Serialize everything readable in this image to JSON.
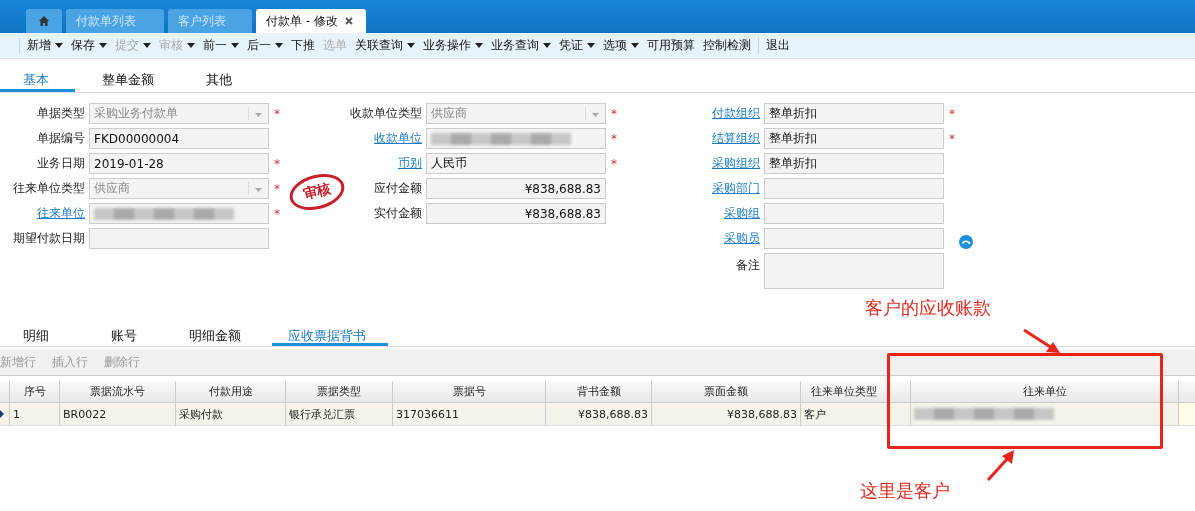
{
  "window_tabs": [
    {
      "kind": "home",
      "selected": false
    },
    {
      "kind": "text",
      "label": "付款单列表",
      "selected": false
    },
    {
      "kind": "text",
      "label": "客户列表",
      "selected": false
    },
    {
      "kind": "text",
      "label": "付款单 - 修改",
      "selected": true,
      "closable": true
    }
  ],
  "toolbar": [
    {
      "label": "新增",
      "dropdown": true,
      "disabled": false,
      "separator": false
    },
    {
      "label": "保存",
      "dropdown": true,
      "disabled": false,
      "separator": false
    },
    {
      "label": "提交",
      "dropdown": true,
      "disabled": true,
      "separator": false
    },
    {
      "label": "审核",
      "dropdown": true,
      "disabled": true,
      "separator": false
    },
    {
      "label": "前一",
      "dropdown": true,
      "disabled": false,
      "separator": false
    },
    {
      "label": "后一",
      "dropdown": true,
      "disabled": false,
      "separator": false
    },
    {
      "label": "下推",
      "dropdown": false,
      "disabled": false,
      "separator": false
    },
    {
      "label": "选单",
      "dropdown": false,
      "disabled": true,
      "separator": false
    },
    {
      "label": "关联查询",
      "dropdown": true,
      "disabled": false,
      "separator": false
    },
    {
      "label": "业务操作",
      "dropdown": true,
      "disabled": false,
      "separator": false
    },
    {
      "label": "业务查询",
      "dropdown": true,
      "disabled": false,
      "separator": false
    },
    {
      "label": "凭证",
      "dropdown": true,
      "disabled": false,
      "separator": false
    },
    {
      "label": "选项",
      "dropdown": true,
      "disabled": false,
      "separator": false
    },
    {
      "label": "可用预算",
      "dropdown": false,
      "disabled": false,
      "separator": false
    },
    {
      "label": "控制检测",
      "dropdown": false,
      "disabled": false,
      "separator": false
    },
    {
      "label": "退出",
      "dropdown": false,
      "disabled": false,
      "separator": true
    }
  ],
  "form_tabs": [
    {
      "label": "基本",
      "selected": true
    },
    {
      "label": "整单金额",
      "selected": false
    },
    {
      "label": "其他",
      "selected": false
    }
  ],
  "form": {
    "stamp": "审核",
    "columns": [
      [
        {
          "label": "单据类型",
          "link": false,
          "kind": "select",
          "value": "采购业务付款单",
          "disabled": true,
          "required_mark": "*"
        },
        {
          "label": "单据编号",
          "link": false,
          "kind": "text",
          "value": "FKD00000004",
          "disabled": false
        },
        {
          "label": "业务日期",
          "link": false,
          "kind": "text",
          "value": "2019-01-28",
          "disabled": false,
          "required_mark": "*"
        },
        {
          "label": "往来单位类型",
          "link": false,
          "kind": "select",
          "value": "供应商",
          "disabled": true,
          "required_mark": "*"
        },
        {
          "label": "往来单位",
          "link": true,
          "kind": "text",
          "redacted": true,
          "required_mark": "*"
        },
        {
          "label": "期望付款日期",
          "link": false,
          "kind": "text"
        }
      ],
      [
        {
          "label": "收款单位类型",
          "link": false,
          "kind": "select",
          "value": "供应商",
          "disabled": true,
          "required_mark": "*"
        },
        {
          "label": "收款单位",
          "link": true,
          "kind": "text",
          "redacted": true,
          "required_mark": "*"
        },
        {
          "label": "币别",
          "link": true,
          "kind": "text",
          "value": "人民币",
          "disabled": false,
          "required_mark": "*"
        },
        {
          "label": "应付金额",
          "link": false,
          "kind": "amount",
          "value": "¥838,688.83",
          "disabled": false
        },
        {
          "label": "实付金额",
          "link": false,
          "kind": "amount",
          "value": "¥838,688.83",
          "disabled": false
        }
      ],
      [
        {
          "label": "付款组织",
          "link": true,
          "kind": "text",
          "value": "整单折扣",
          "disabled": false,
          "required_mark": "*"
        },
        {
          "label": "结算组织",
          "link": true,
          "kind": "text",
          "value": "整单折扣",
          "disabled": false,
          "required_mark": "*"
        },
        {
          "label": "采购组织",
          "link": true,
          "kind": "text",
          "value": "整单折扣",
          "disabled": false
        },
        {
          "label": "采购部门",
          "link": true,
          "kind": "text"
        },
        {
          "label": "采购组",
          "link": true,
          "kind": "text"
        },
        {
          "label": "采购员",
          "link": true,
          "kind": "text",
          "action_icon": true
        },
        {
          "label": "备注",
          "link": false,
          "kind": "textarea"
        }
      ]
    ]
  },
  "detail_tabs": [
    {
      "label": "明细",
      "selected": false
    },
    {
      "label": "账号",
      "selected": false
    },
    {
      "label": "明细金额",
      "selected": false
    },
    {
      "label": "应收票据背书",
      "selected": true
    }
  ],
  "grid_toolbar": [
    {
      "label": "新增行",
      "disabled": true
    },
    {
      "label": "插入行",
      "disabled": true
    },
    {
      "label": "删除行",
      "disabled": true
    }
  ],
  "table": {
    "columns": [
      {
        "label": "序号",
        "kind": "text"
      },
      {
        "label": "票据流水号",
        "kind": "text"
      },
      {
        "label": "付款用途",
        "kind": "text"
      },
      {
        "label": "票据类型",
        "kind": "text"
      },
      {
        "label": "票据号",
        "kind": "text"
      },
      {
        "label": "背书金额",
        "kind": "amount"
      },
      {
        "label": "票面金额",
        "kind": "amount"
      },
      {
        "label": "往来单位类型",
        "kind": "text"
      },
      {
        "label": "往来单位",
        "kind": "text"
      }
    ],
    "rows": [
      {
        "current": true,
        "cells": [
          {
            "value": "1"
          },
          {
            "value": "BR0022"
          },
          {
            "value": "采购付款"
          },
          {
            "value": "银行承兑汇票"
          },
          {
            "value": "317036611"
          },
          {
            "value": "¥838,688.83"
          },
          {
            "value": "¥838,688.83"
          },
          {
            "value": "客户"
          },
          {
            "redacted": true
          }
        ]
      }
    ]
  },
  "annotations": [
    {
      "kind": "top",
      "text": "客户的应收账款"
    },
    {
      "kind": "bottom",
      "text": "这里是客户"
    }
  ]
}
